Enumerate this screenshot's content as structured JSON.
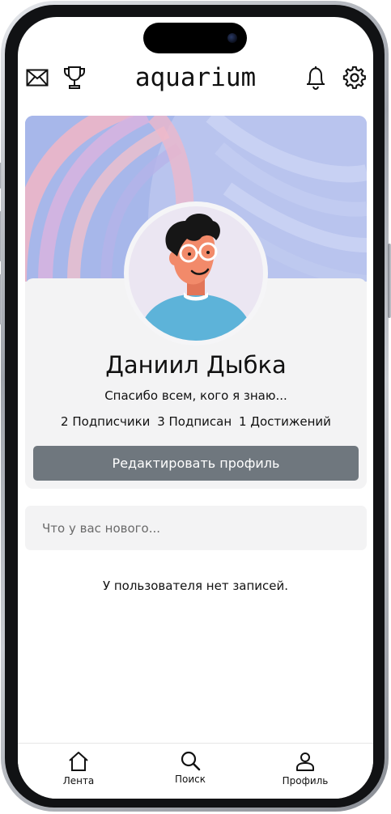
{
  "header": {
    "app_title": "aquarium",
    "left_icons": [
      "mail-icon",
      "trophy-icon"
    ],
    "right_icons": [
      "bell-icon",
      "gear-icon"
    ]
  },
  "profile": {
    "name": "Даниил Дыбка",
    "status": "Спасибо всем, кого я знаю...",
    "stats": {
      "followers": "2 Подписчики",
      "following": "3 Подписан",
      "achievements": "1 Достижений"
    },
    "edit_button_label": "Редактировать профиль"
  },
  "composer": {
    "placeholder": "Что у вас нового...",
    "value": ""
  },
  "feed": {
    "empty_message": "У пользователя нет записей."
  },
  "tabbar": {
    "items": [
      {
        "label": "Лента",
        "icon": "home-icon"
      },
      {
        "label": "Поиск",
        "icon": "search-icon"
      },
      {
        "label": "Профиль",
        "icon": "user-icon"
      }
    ]
  },
  "colors": {
    "edit_button_bg": "#6f777e",
    "card_bg": "#f3f3f4",
    "avatar_shirt": "#5db3d9",
    "avatar_skin": "#f28a6a"
  }
}
